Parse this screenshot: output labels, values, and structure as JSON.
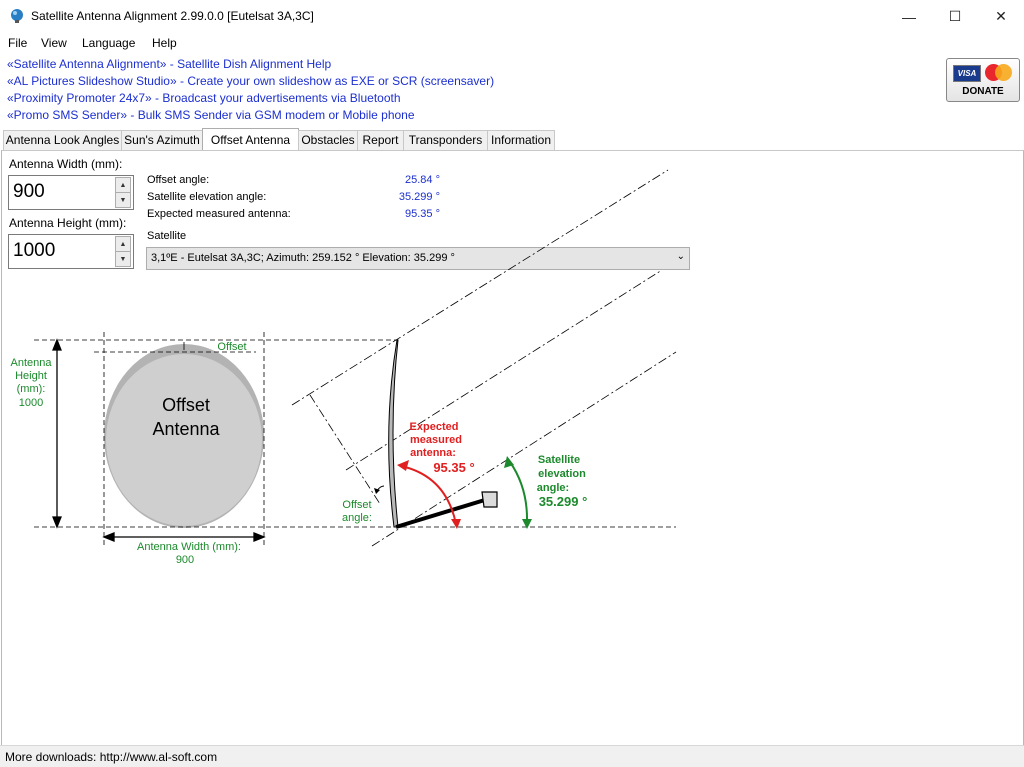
{
  "window": {
    "title": "Satellite Antenna Alignment 2.99.0.0 [Eutelsat 3A,3C]",
    "minimize": "—",
    "maximize": "☐",
    "close": "✕"
  },
  "menu": [
    "File",
    "View",
    "Language",
    "Help"
  ],
  "ads": [
    "«Satellite Antenna Alignment» - Satellite Dish Alignment Help",
    "«AL Pictures Slideshow Studio» - Create your own slideshow as EXE or SCR (screensaver)",
    "«Proximity Promoter 24x7» - Broadcast your advertisements via Bluetooth",
    "«Promo SMS Sender» - Bulk SMS Sender via GSM modem or Mobile phone"
  ],
  "donate": {
    "label": "DONATE",
    "visa": "VISA"
  },
  "tabs": [
    "Antenna Look Angles",
    "Sun's Azimuth",
    "Offset Antenna",
    "Obstacles",
    "Report",
    "Transponders",
    "Information"
  ],
  "active_tab": "Offset Antenna",
  "form": {
    "width_label": "Antenna Width (mm):",
    "width_value": "900",
    "height_label": "Antenna Height (mm):",
    "height_value": "1000"
  },
  "results": {
    "offset_label": "Offset angle:",
    "offset_value": "25.84 °",
    "elevation_label": "Satellite elevation angle:",
    "elevation_value": "35.299 °",
    "expected_label": "Expected measured antenna:",
    "expected_value": "95.35 °"
  },
  "satellite": {
    "label": "Satellite",
    "selected": "3,1ºE - Eutelsat 3A,3C;  Azimuth: 259.152 °  Elevation: 35.299 °"
  },
  "diagram": {
    "dish_line1": "Offset",
    "dish_line2": "Antenna",
    "offset_top": "Offset",
    "height_l1": "Antenna",
    "height_l2": "Height",
    "height_l3": "(mm):",
    "height_val": "1000",
    "width_lbl": "Antenna Width (mm):",
    "width_val": "900",
    "offset_angle_l1": "Offset",
    "offset_angle_l2": "angle:",
    "expected_l1": "Expected",
    "expected_l2": "measured",
    "expected_l3": "antenna:",
    "expected_val": "95.35 °",
    "elev_l1": "Satellite",
    "elev_l2": "elevation",
    "elev_l3": "angle:",
    "elev_val": "35.299 °"
  },
  "colors": {
    "link": "#1c2fd0",
    "green": "#1c8a2c",
    "red": "#e02020",
    "dish": "#c8c8c8"
  },
  "status": "More downloads: http://www.al-soft.com"
}
